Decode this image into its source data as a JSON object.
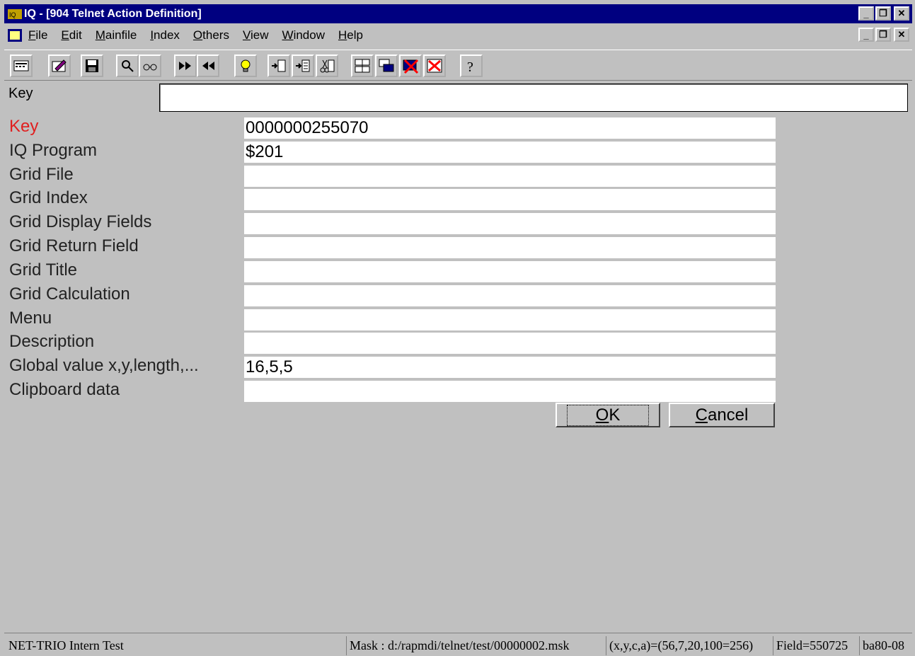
{
  "window": {
    "title": "IQ - [904  Telnet Action Definition]"
  },
  "menu": {
    "items": [
      {
        "label": "File",
        "ul": "F",
        "rest": "ile"
      },
      {
        "label": "Edit",
        "ul": "E",
        "rest": "dit"
      },
      {
        "label": "Mainfile",
        "ul": "M",
        "rest": "ainfile"
      },
      {
        "label": "Index",
        "ul": "I",
        "rest": "ndex"
      },
      {
        "label": "Others",
        "ul": "O",
        "rest": "thers"
      },
      {
        "label": "View",
        "ul": "V",
        "rest": "iew"
      },
      {
        "label": "Window",
        "ul": "W",
        "rest": "indow"
      },
      {
        "label": "Help",
        "ul": "H",
        "rest": "elp"
      }
    ]
  },
  "toolbar": {
    "icons": [
      "calculator-icon",
      "edit-icon",
      "save-icon",
      "search-icon",
      "glasses-icon",
      "next-icon",
      "previous-icon",
      "lightbulb-icon",
      "insert-icon",
      "insert-file-icon",
      "cut-icon",
      "layout-icon",
      "windows-icon",
      "delete-record-icon",
      "close-icon",
      "help-icon"
    ]
  },
  "search": {
    "label": "Key",
    "value": ""
  },
  "form": {
    "fields": [
      {
        "label": "Key",
        "value": "0000000255070"
      },
      {
        "label": "IQ Program",
        "value": "$201"
      },
      {
        "label": "Grid File",
        "value": ""
      },
      {
        "label": "Grid Index",
        "value": ""
      },
      {
        "label": "Grid Display Fields",
        "value": ""
      },
      {
        "label": "Grid Return Field",
        "value": ""
      },
      {
        "label": "Grid Title",
        "value": ""
      },
      {
        "label": "Grid Calculation",
        "value": ""
      },
      {
        "label": "Menu",
        "value": ""
      },
      {
        "label": "Description",
        "value": ""
      },
      {
        "label": "Global value x,y,length,...",
        "value": "16,5,5"
      },
      {
        "label": "Clipboard data",
        "value": ""
      }
    ],
    "ok_ul": "O",
    "ok_rest": "K",
    "cancel_ul": "C",
    "cancel_rest": "ancel"
  },
  "status": {
    "left": "NET-TRIO Intern Test",
    "mask": "Mask : d:/rapmdi/telnet/test/00000002.msk",
    "coords": "(x,y,c,a)=(56,7,20,100=256)",
    "field": "Field=550725",
    "version": "ba80-08"
  }
}
